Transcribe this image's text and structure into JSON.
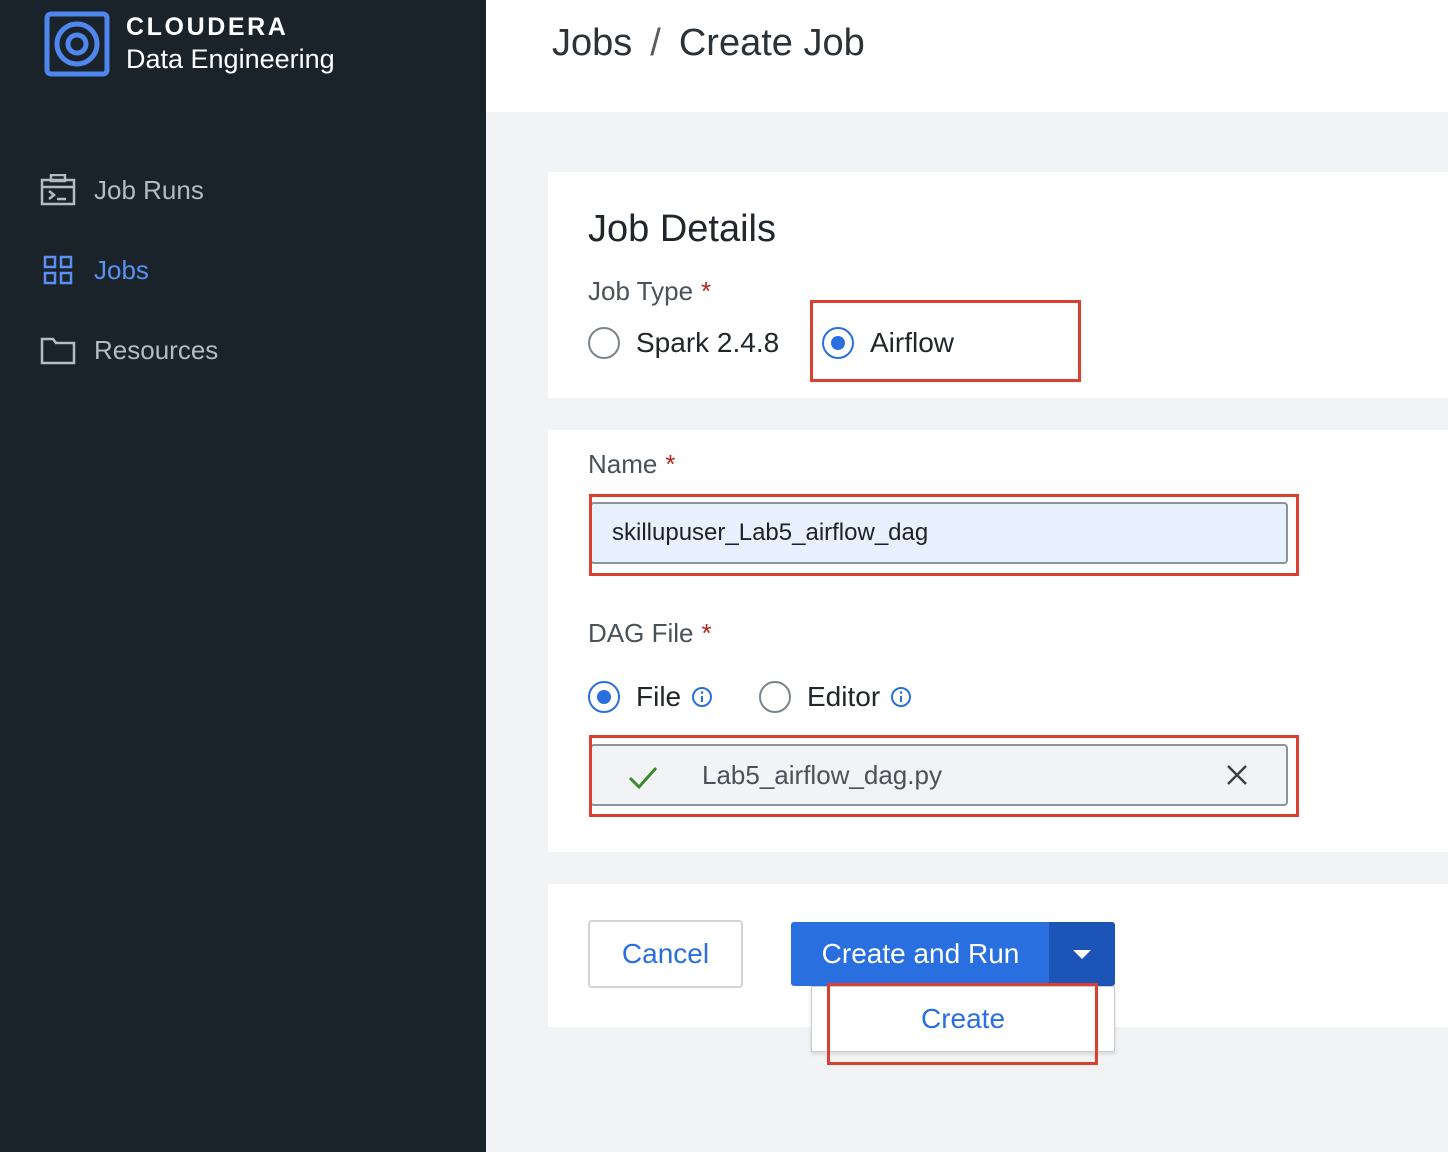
{
  "app": {
    "brand": "CLOUDERA",
    "product": "Data Engineering"
  },
  "sidebar": {
    "items": [
      {
        "label": "Job Runs",
        "icon": "terminal-window-icon",
        "active": false
      },
      {
        "label": "Jobs",
        "icon": "grid-icon",
        "active": true
      },
      {
        "label": "Resources",
        "icon": "folder-icon",
        "active": false
      }
    ]
  },
  "breadcrumb": {
    "parent": "Jobs",
    "separator": "/",
    "current": "Create Job"
  },
  "job_details": {
    "title": "Job Details",
    "job_type_label": "Job Type",
    "required_mark": "*",
    "job_type_options": [
      {
        "label": "Spark 2.4.8",
        "selected": false
      },
      {
        "label": "Airflow",
        "selected": true
      }
    ]
  },
  "name_field": {
    "label": "Name",
    "value": "skillupuser_Lab5_airflow_dag"
  },
  "dag_file": {
    "label": "DAG File",
    "source_options": [
      {
        "label": "File",
        "selected": true,
        "icon": "info-icon"
      },
      {
        "label": "Editor",
        "selected": false,
        "icon": "info-icon"
      }
    ],
    "uploaded_file": "Lab5_airflow_dag.py",
    "upload_status_icon": "checkmark-icon"
  },
  "actions": {
    "cancel_label": "Cancel",
    "primary_label": "Create and Run",
    "dropdown_items": [
      "Create"
    ]
  },
  "colors": {
    "sidebar_bg": "#1a232a",
    "accent": "#2a6fe0",
    "annotation": "#d9402f",
    "success": "#3c8a2e"
  }
}
